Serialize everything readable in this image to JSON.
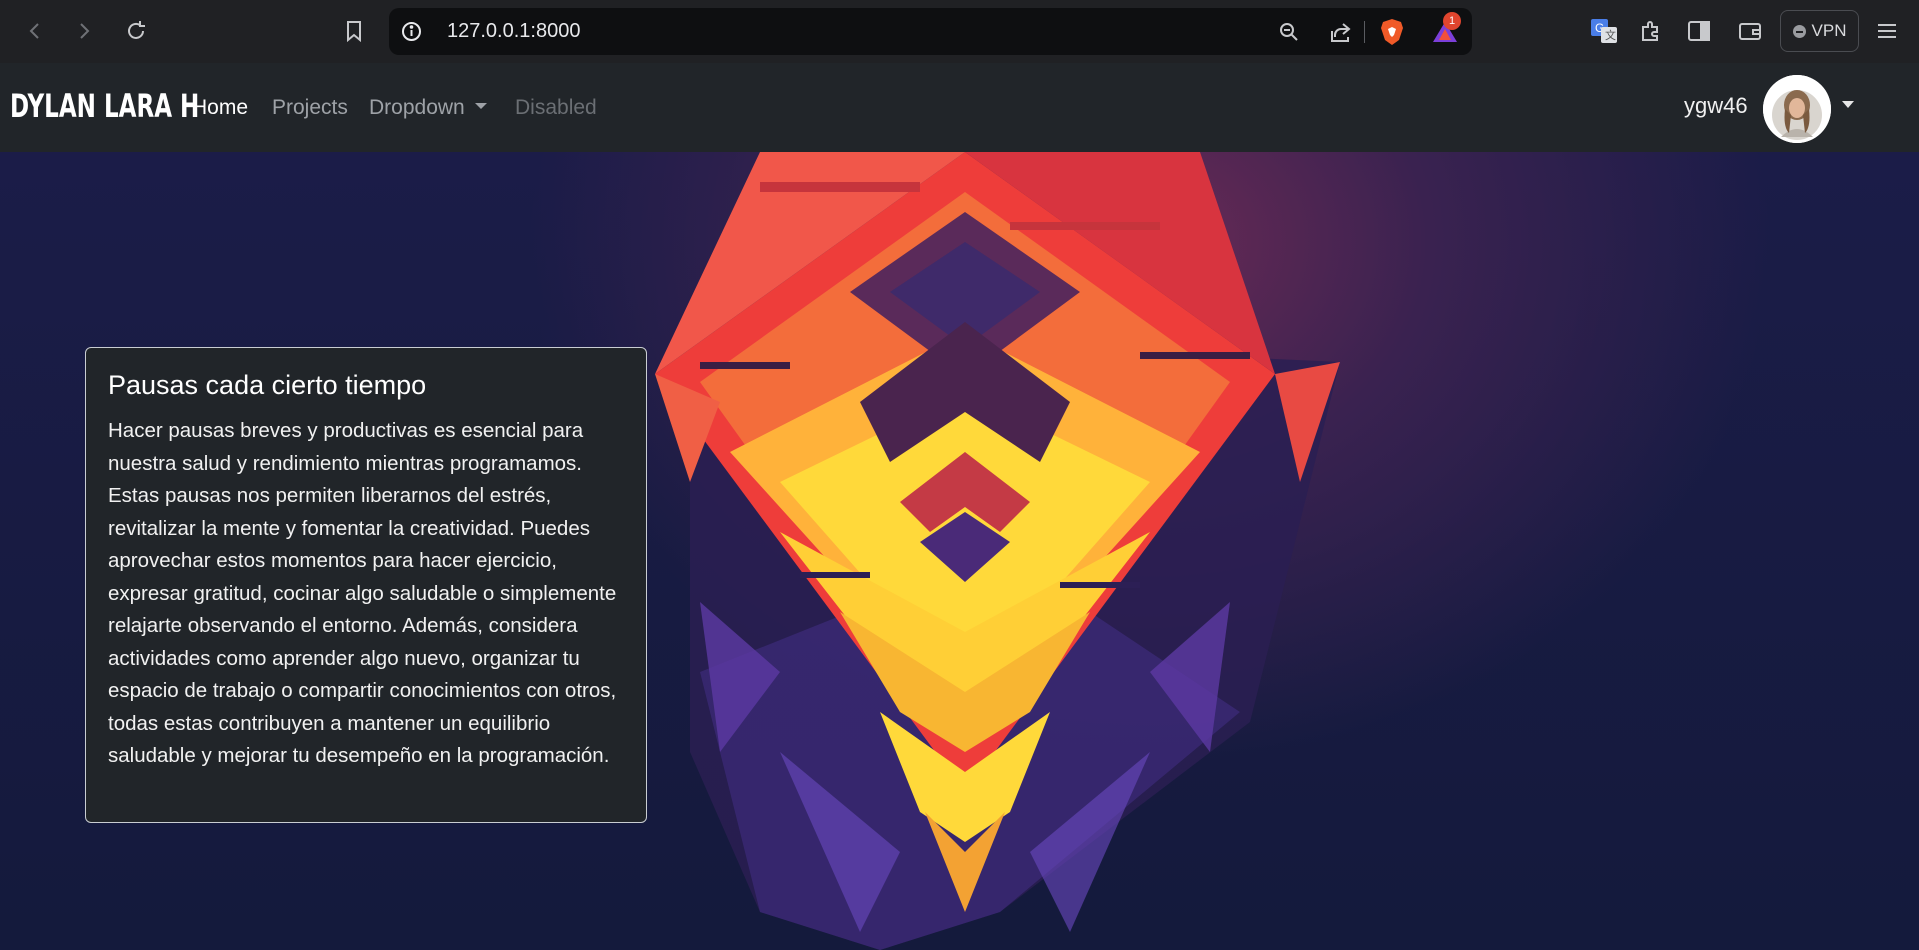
{
  "browser": {
    "url": "127.0.0.1:8000",
    "notification_count": "1",
    "vpn_label": "VPN",
    "icons": [
      "back-icon",
      "forward-icon",
      "reload-icon",
      "bookmark-icon",
      "site-info-icon",
      "zoom-icon",
      "share-icon",
      "brave-shields-icon",
      "brave-rewards-icon",
      "translate-icon",
      "extensions-icon",
      "sidebar-icon",
      "wallet-icon",
      "menu-icon"
    ]
  },
  "navbar": {
    "brand": "DYLAN LARA H",
    "links": [
      {
        "label": "Home"
      },
      {
        "label": "Projects"
      },
      {
        "label": "Dropdown"
      },
      {
        "label": "Disabled"
      }
    ],
    "username": "ygw46"
  },
  "card": {
    "title": "Pausas cada cierto tiempo",
    "body": "Hacer pausas breves y productivas es esencial para nuestra salud y rendimiento mientras programamos. Estas pausas nos permiten liberarnos del estrés, revitalizar la mente y fomentar la creatividad. Puedes aprovechar estos momentos para hacer ejercicio, expresar gratitud, cocinar algo saludable o simplemente relajarte observando el entorno. Además, considera actividades como aprender algo nuevo, organizar tu espacio de trabajo o compartir conocimientos con otros, todas estas contribuyen a mantener un equilibrio saludable y mejorar tu desempeño en la programación."
  },
  "colors": {
    "navbar_bg": "#212529",
    "hero_bg": "#141a3c",
    "accent_red": "#f0403a",
    "accent_yellow": "#ffd93a"
  }
}
